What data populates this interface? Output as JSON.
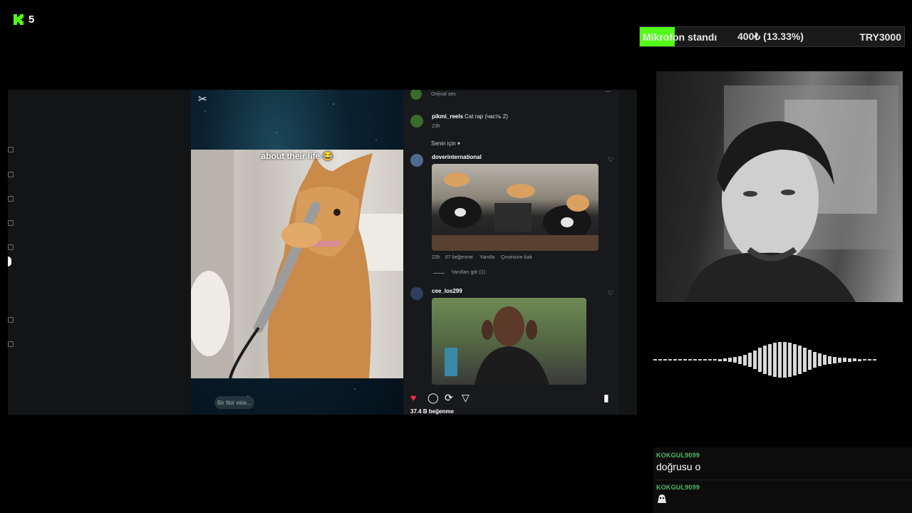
{
  "overlay": {
    "logo_letter": "K",
    "viewer_count": "5",
    "accent_color": "#53fc18"
  },
  "goal": {
    "name": "Mikrofon standı",
    "amount": "400₺ (13.33%)",
    "target": "TRY3000",
    "progress": 0.1333
  },
  "reel": {
    "caption": "about their life 😂",
    "comment_placeholder": "Bir fikir ekle..."
  },
  "comments": {
    "original_sound": "Orijinal ses",
    "post_user": "pikmi_reels",
    "post_text": "Cat rap (часть 2)",
    "post_time": "23h",
    "sort_label": "Senin için ▾",
    "items": [
      {
        "user": "doverinternational",
        "time": "22h",
        "likes": "67 beğenme",
        "reply": "Yanıtla",
        "translate": "Çevirisine bak",
        "view_replies": "Yanıtları gör (1)"
      },
      {
        "user": "cee_los299"
      }
    ],
    "total_likes": "37.4 B beğenme"
  },
  "chat": {
    "messages": [
      {
        "user": "KOKGUL9099",
        "text": "doğrusu o"
      },
      {
        "user": "KOKGUL9099",
        "text": ""
      }
    ]
  }
}
